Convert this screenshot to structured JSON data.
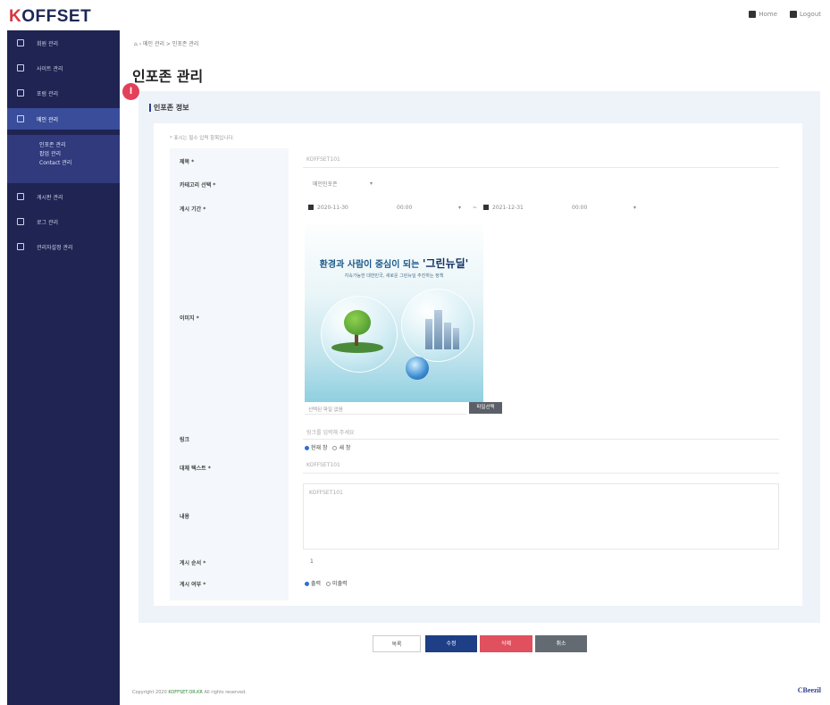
{
  "app": {
    "logo_prefix": "K",
    "logo_rest": "OFFSET"
  },
  "header": {
    "home_label": "Home",
    "logout_label": "Logout"
  },
  "sidebar": {
    "items": [
      {
        "label": "회원 관리",
        "icon": "settings-icon"
      },
      {
        "label": "사이트 관리",
        "icon": "grid-icon"
      },
      {
        "label": "포럼 관리",
        "icon": "users-icon"
      },
      {
        "label": "메인 관리",
        "icon": "layout-icon",
        "active": true
      },
      {
        "label": "게시판 관리",
        "icon": "board-icon"
      },
      {
        "label": "로그 관리",
        "icon": "log-icon"
      },
      {
        "label": "관리자설정 관리",
        "icon": "admin-icon"
      }
    ],
    "submenu": [
      "인포존 관리",
      "팝업 관리",
      "Contact 관리"
    ]
  },
  "breadcrumb": "메인 관리 > 인포존 관리",
  "page_title": "인포존 관리",
  "marker_label": "I",
  "section_title": "인포존 정보",
  "required_note": "* 표시는 필수 입력 항목입니다.",
  "form": {
    "title": {
      "label": "제목 *",
      "value": "KOFFSET101"
    },
    "category": {
      "label": "카테고리 선택 *",
      "value": "메인인포존"
    },
    "period": {
      "label": "게시 기간 *",
      "start_date": "2020-11-30",
      "start_time": "00:00",
      "end_date": "2021-12-31",
      "end_time": "00:00",
      "separator": "~"
    },
    "image": {
      "label": "이미지 *",
      "banner_headline_prefix": "환경과 사람이 중심이 되는",
      "banner_headline_bold": "'그린뉴딜'",
      "banner_sub": "지속가능한 대한민국, 새로운 그린뉴딜 추진하는 정책",
      "file_placeholder": "선택된 파일 없음",
      "file_button": "파일선택"
    },
    "link": {
      "label": "링크",
      "placeholder": "링크를 입력해 주세요",
      "options": [
        "현재 창",
        "새 창"
      ]
    },
    "alt_text": {
      "label": "대체 텍스트 *",
      "value": "KOFFSET101"
    },
    "content": {
      "label": "내용",
      "value": "KOFFSET101"
    },
    "order": {
      "label": "게시 순서 *",
      "value": "1"
    },
    "display": {
      "label": "게시 여부 *",
      "options": [
        "출력",
        "미출력"
      ]
    }
  },
  "buttons": {
    "list": "목록",
    "edit": "수정",
    "delete": "삭제",
    "cancel": "취소"
  },
  "footer": {
    "prefix": "Copyright 2020",
    "highlight": "KOFFSET.OR.KR",
    "suffix": "All rights reserved."
  },
  "brand2": "CBeezil",
  "colors": {
    "sidebar": "#1f2452",
    "active": "#3a4d9a",
    "edit": "#1e3f86",
    "delete": "#e0505e",
    "cancel": "#636a72",
    "marker": "#e3405a"
  }
}
